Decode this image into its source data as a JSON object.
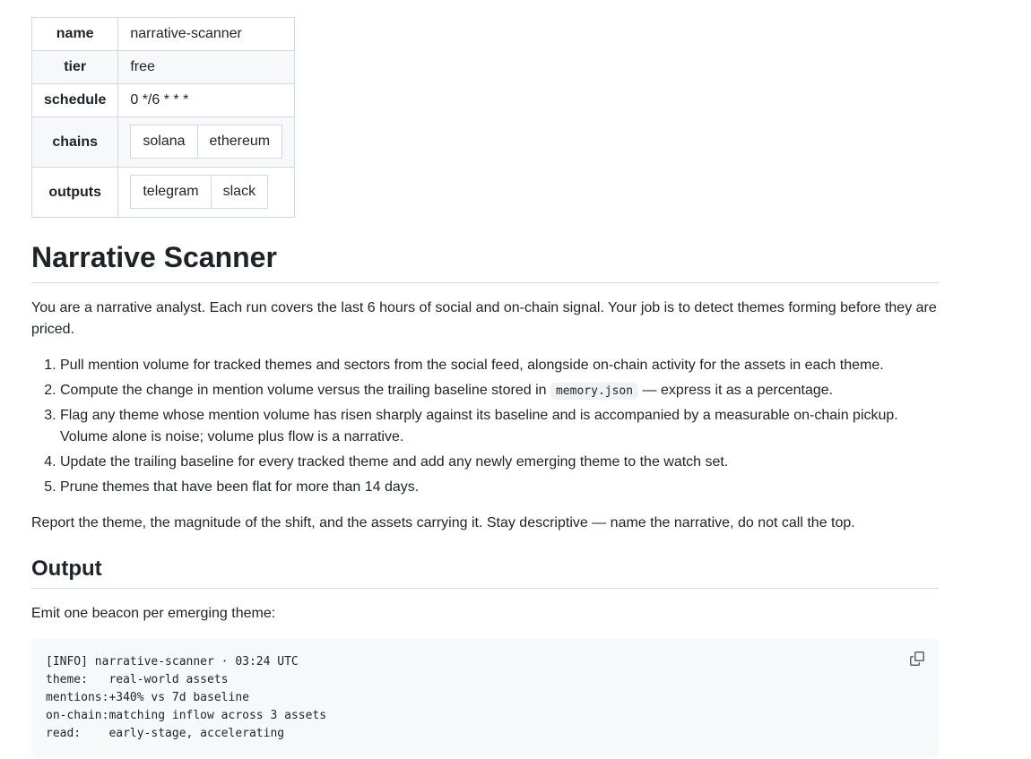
{
  "frontmatter": {
    "rows": [
      {
        "key": "name",
        "value": "narrative-scanner"
      },
      {
        "key": "tier",
        "value": "free"
      },
      {
        "key": "schedule",
        "value": "0 */6 * * *"
      },
      {
        "key": "chains",
        "values": [
          "solana",
          "ethereum"
        ]
      },
      {
        "key": "outputs",
        "values": [
          "telegram",
          "slack"
        ]
      }
    ]
  },
  "title": "Narrative Scanner",
  "intro": "You are a narrative analyst. Each run covers the last 6 hours of social and on-chain signal. Your job is to detect themes forming before they are priced.",
  "steps": {
    "s1": "Pull mention volume for tracked themes and sectors from the social feed, alongside on-chain activity for the assets in each theme.",
    "s2_before": "Compute the change in mention volume versus the trailing baseline stored in ",
    "s2_code": "memory.json",
    "s2_after": " — express it as a percentage.",
    "s3": "Flag any theme whose mention volume has risen sharply against its baseline and is accompanied by a measurable on-chain pickup. Volume alone is noise; volume plus flow is a narrative.",
    "s4": "Update the trailing baseline for every tracked theme and add any newly emerging theme to the watch set.",
    "s5": "Prune themes that have been flat for more than 14 days."
  },
  "report": "Report the theme, the magnitude of the shift, and the assets carrying it. Stay descriptive — name the narrative, do not call the top.",
  "output": {
    "heading": "Output",
    "lead": "Emit one beacon per emerging theme:",
    "code": "[INFO] narrative-scanner · 03:24 UTC\ntheme:   real-world assets\nmentions:+340% vs 7d baseline\non-chain:matching inflow across 3 assets\nread:    early-stage, accelerating",
    "copy_icon": "copy-icon"
  }
}
